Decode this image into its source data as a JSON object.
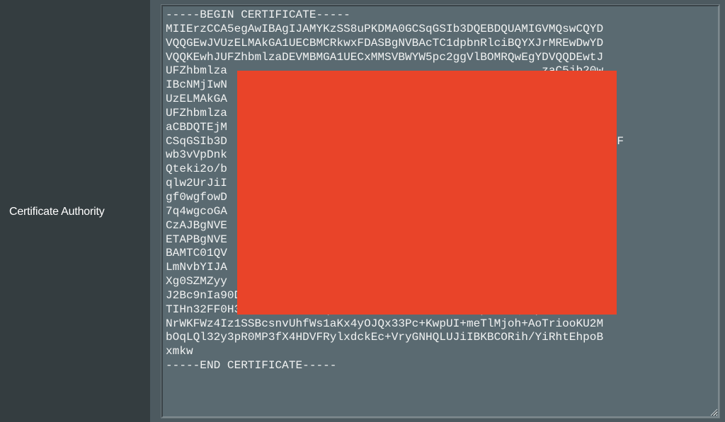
{
  "field": {
    "label": "Certificate Authority"
  },
  "certificate": {
    "lines": [
      "-----BEGIN CERTIFICATE-----",
      "MIIErzCCA5egAwIBAgIJAMYKzSS8uPKDMA0GCSqGSIb3DQEBDQUAMIGVMQswCQYD",
      "VQQGEwJVUzELMAkGA1UECBMCRkwxFDASBgNVBAcTC1dpbnRlciBQYXJrMREwDwYD",
      "VQQKEwhJUFZhbmlzaDEVMBMGA1UECxMMSVBWYW5pc2ggVlBOMRQwEgYDVQQDEwtJ",
      "UFZhbmlza                                              zaC5jb20w",
      "IBcNMjIwN                                              YDVQQGEwJV",
      "UzELMAkGA                                              YDVQQKEwhJ",
      "UFZhbmlza                                              JUFZhbmlz",
      "aCBDQTEjM                                              0wggEiMA0G",
      "CSqGSIb3D                                              PtupXgc6LXfF",
      "wb3vVpDnk                                              loSwlmsGAC",
      "Qteki2o/b                                              gm25jgPDkr",
      "qlw2UrJiI                                              ELAgMBAAGj",
      "gf0wgfowD                                              f2nxEcJU4Z",
      "7q4wgcoGA                                              akgZgwgZUx",
      "CzAJBgNVE                                              VyIFBhcmsx",
      "ETAPBgNVE                                              xFDASBgNV",
      "BAMTC01QV                                              wdmFuaXNo",
      "LmNvbYIJA                                              BfBrF/BQT",
      "Xg0SZMZyy                                              Zhu9BJ4GiY",
      "J2Bc9nIa90D1NGYgiOVYLGXfUUqy5FgfrsWh0Go5oYm9l7W9pWfIifwsaZynkY0r",
      "TIHn32FF0H3+wZrGrEUzVL6qi+KD8iR3cBbLT+xUzulMTBp4JYaQnxpV4fZNS0Zs",
      "NrWKFWz4Iz1SSBcsnvUhfWs1aKx4yOJQx33Pc+KwpUI+meTlMjoh+AoTriooKU2M",
      "bOqLQl32y3pR0MP3fX4HDVFRylxdckEc+VryGNHQLUJiIBKBCORih/YiRhtEhpoB",
      "xmkw",
      "-----END CERTIFICATE-----"
    ],
    "redacted": true
  },
  "colors": {
    "label_background": "#343d40",
    "field_background": "#4d5a60",
    "textarea_background": "#5a6a71",
    "text": "#f0f2f2",
    "redaction": "#e94429"
  }
}
